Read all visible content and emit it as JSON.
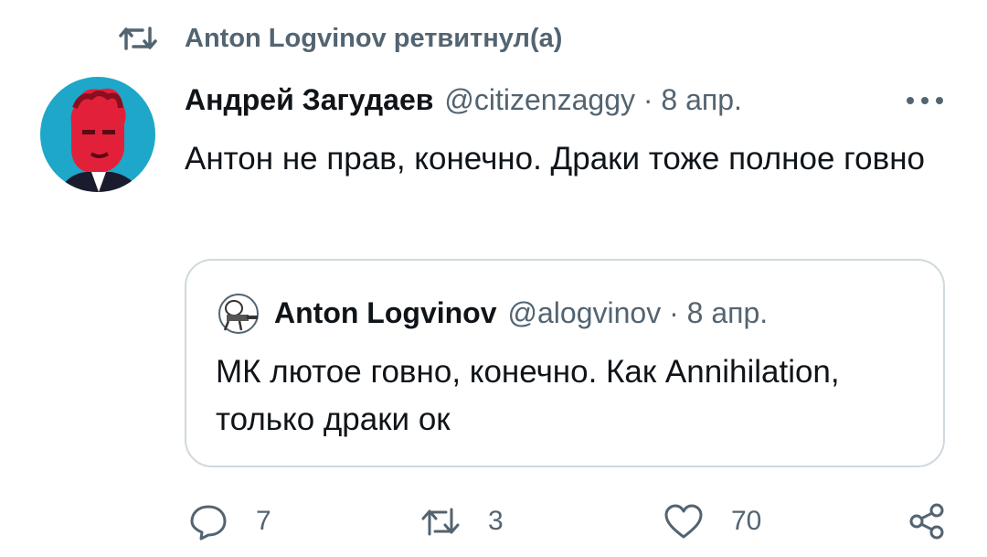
{
  "retweet_banner": {
    "text": "Anton Logvinov ретвитнул(а)",
    "icon": "retweet-icon"
  },
  "tweet": {
    "author_name": "Андрей Загудаев",
    "meta": "@citizenzaggy · 8 апр.",
    "text": "Антон не прав, конечно. Драки тоже полное говно",
    "more_icon": "more-dots-icon",
    "colors": {
      "avatar_bg": "#1ea7c8",
      "avatar_face": "#e3203a"
    }
  },
  "quote": {
    "author_name": "Anton Logvinov",
    "meta": "@alogvinov · 8 апр.",
    "text": "МК лютое говно, конечно. Как Annihilation, только драки ок"
  },
  "actions": {
    "reply": {
      "icon": "reply-icon",
      "count": "7"
    },
    "retweet": {
      "icon": "retweet-icon",
      "count": "3"
    },
    "like": {
      "icon": "heart-icon",
      "count": "70"
    },
    "share": {
      "icon": "share-icon"
    }
  },
  "colors": {
    "text": "#0f1419",
    "secondary": "#536471",
    "border": "#cfd9de"
  }
}
